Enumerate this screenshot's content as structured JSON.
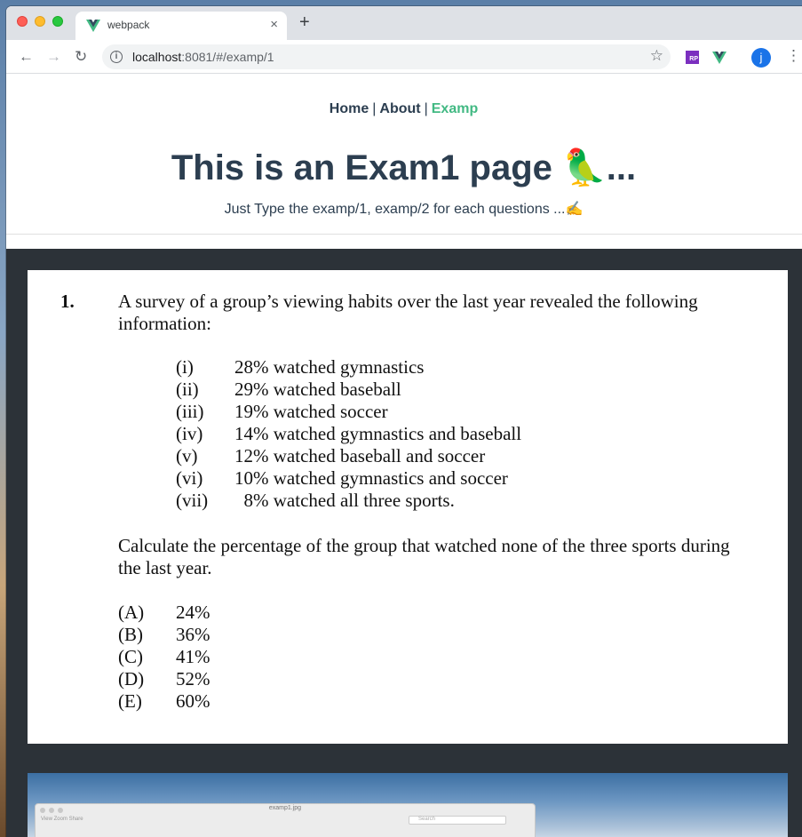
{
  "browser": {
    "tab_title": "webpack",
    "tab_close": "×",
    "new_tab": "+",
    "url_host": "localhost",
    "url_path": ":8081/#/examp/1",
    "extension_rp": "RP",
    "profile_initial": "j"
  },
  "nav": {
    "home": "Home",
    "about": "About",
    "examp": "Examp",
    "separator": "|",
    "active_color": "#42b983"
  },
  "page": {
    "title": "This is an Exam1 page 🦜...",
    "subtitle": "Just Type the examp/1, examp/2 for each questions ...✍"
  },
  "exam": {
    "number": "1.",
    "question": "A survey of a group’s viewing habits over the last year revealed the following information:",
    "items": [
      {
        "roman": "(i)",
        "text": "28% watched gymnastics"
      },
      {
        "roman": "(ii)",
        "text": "29% watched baseball"
      },
      {
        "roman": "(iii)",
        "text": "19% watched soccer"
      },
      {
        "roman": "(iv)",
        "text": "14% watched gymnastics and baseball"
      },
      {
        "roman": "(v)",
        "text": "12% watched baseball and soccer"
      },
      {
        "roman": "(vi)",
        "text": "10% watched gymnastics and soccer"
      },
      {
        "roman": "(vii)",
        "text": "  8% watched all three sports."
      }
    ],
    "prompt": "Calculate the percentage of the group that watched none of the three sports during the last year.",
    "choices": [
      {
        "letter": "(A)",
        "value": "24%"
      },
      {
        "letter": "(B)",
        "value": "36%"
      },
      {
        "letter": "(C)",
        "value": "41%"
      },
      {
        "letter": "(D)",
        "value": "52%"
      },
      {
        "letter": "(E)",
        "value": "60%"
      }
    ]
  },
  "preview": {
    "window_title": "examp1.jpg",
    "tools": "View   Zoom   Share",
    "search_placeholder": "Search"
  }
}
